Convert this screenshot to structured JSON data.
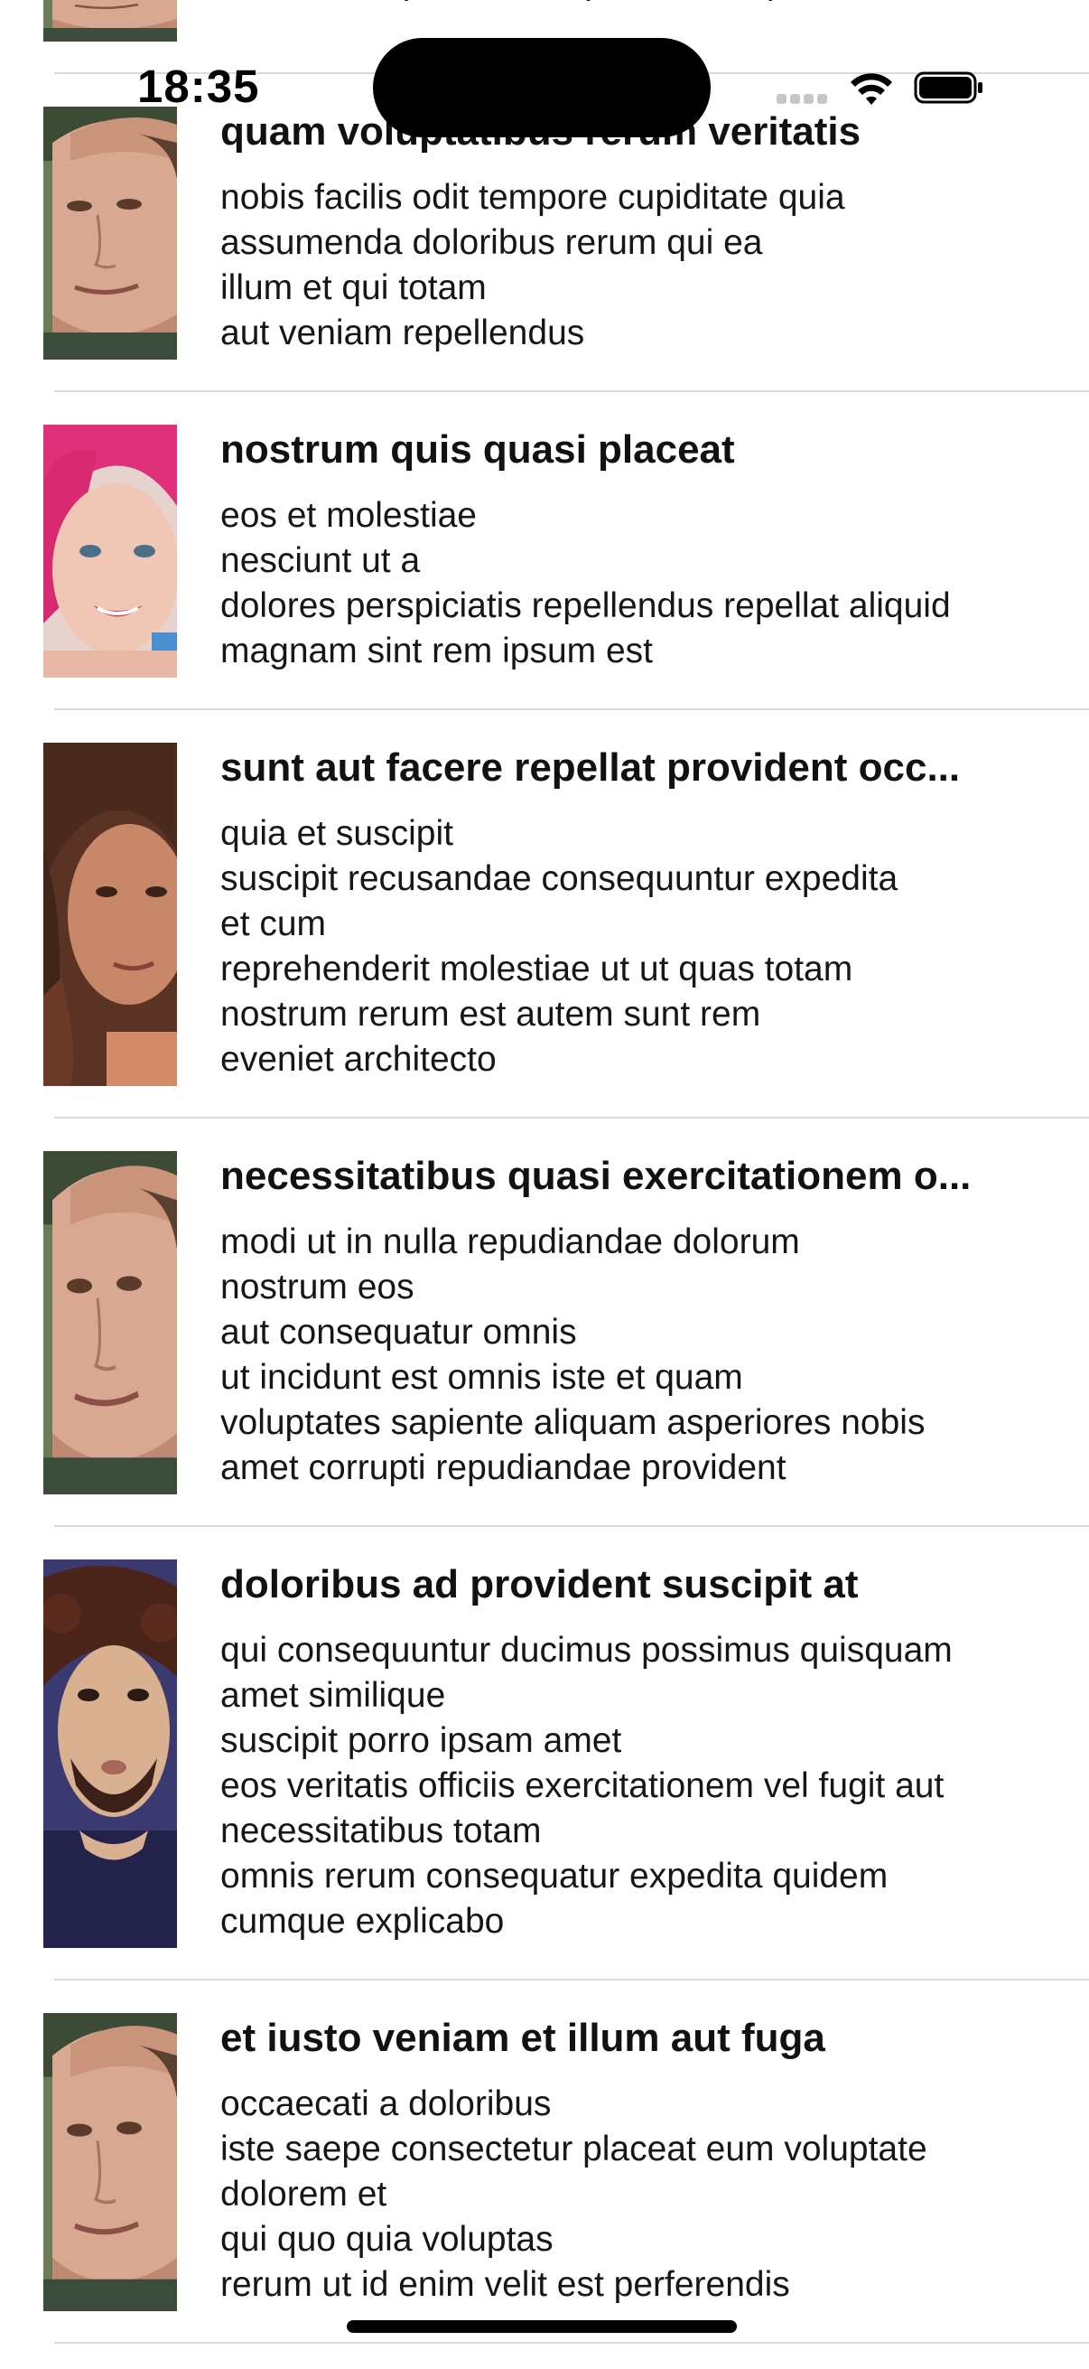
{
  "status_bar": {
    "time": "18:35"
  },
  "posts": [
    {
      "title": "",
      "body": [
        "",
        "et in consequuntur voluptatem voluptates aut"
      ],
      "avatar": "avatar-man-bald"
    },
    {
      "title": "quam voluptatibus rerum veritatis",
      "body": [
        "nobis facilis odit tempore cupiditate quia",
        "assumenda doloribus rerum qui ea",
        "illum et qui totam",
        "aut veniam repellendus"
      ],
      "avatar": "avatar-man-bald"
    },
    {
      "title": "nostrum quis quasi placeat",
      "body": [
        "eos et molestiae",
        "nesciunt ut a",
        "dolores perspiciatis repellendus repellat aliquid",
        "magnam sint rem ipsum est"
      ],
      "avatar": "avatar-woman-pink-hair"
    },
    {
      "title": "sunt aut facere repellat provident occ...",
      "body": [
        "quia et suscipit",
        "suscipit recusandae consequuntur expedita",
        "et cum",
        "reprehenderit molestiae ut ut quas totam",
        "nostrum rerum est autem sunt rem",
        "eveniet architecto"
      ],
      "avatar": "avatar-woman-brown-hair"
    },
    {
      "title": "necessitatibus quasi exercitationem o...",
      "body": [
        "modi ut in nulla repudiandae dolorum",
        "nostrum eos",
        "aut consequatur omnis",
        "ut incidunt est omnis iste et quam",
        "voluptates sapiente aliquam asperiores nobis",
        "amet corrupti repudiandae provident"
      ],
      "avatar": "avatar-man-bald"
    },
    {
      "title": "doloribus ad provident suscipit at",
      "body": [
        "qui consequuntur ducimus possimus quisquam",
        "amet similique",
        "suscipit porro ipsam amet",
        "eos veritatis officiis exercitationem vel fugit aut",
        "necessitatibus totam",
        "omnis rerum consequatur expedita quidem",
        "cumque explicabo"
      ],
      "avatar": "avatar-man-curly-hair"
    },
    {
      "title": "et iusto veniam et illum aut fuga",
      "body": [
        "occaecati a doloribus",
        "iste saepe consectetur placeat eum voluptate",
        "dolorem et",
        "qui quo quia voluptas",
        "rerum ut id enim velit est perferendis"
      ],
      "avatar": "avatar-man-bald"
    }
  ]
}
